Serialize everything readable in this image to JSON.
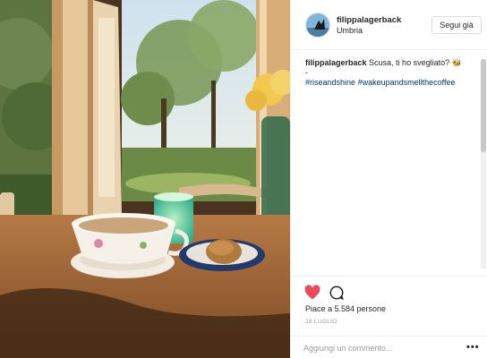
{
  "post": {
    "username": "filippalagerback",
    "location": "Umbria",
    "follow_label": "Segui già",
    "caption": {
      "user": "filippalagerback",
      "text": "Scusa, ti ho svegliato? 🐝",
      "dash": "-",
      "hashtags": [
        "#riseandshine",
        "#wakeupandsmellthecoffee"
      ]
    },
    "likes_text": "Piace a 5.584 persone",
    "date": "28 LUGLIO",
    "comment_placeholder": "Aggiungi un commento...",
    "more_label": "•••"
  },
  "icons": [
    "heart-icon",
    "comment-icon",
    "more-icon"
  ],
  "colors": {
    "like_red": "#ed4956",
    "hashtag": "#003569",
    "border": "#efefef"
  }
}
